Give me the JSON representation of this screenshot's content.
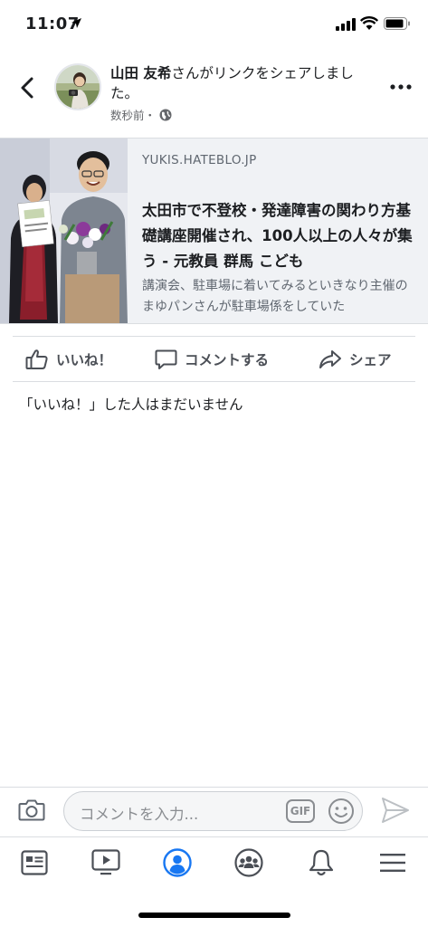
{
  "status_bar": {
    "time": "11:07"
  },
  "post": {
    "author": "山田 友希",
    "action_text": "さんがリンクをシェアしました。",
    "timestamp": "数秒前・"
  },
  "link_card": {
    "domain": "YUKIS.HATEBLO.JP",
    "title": "太田市で不登校・発達障害の関わり方基礎講座開催され、100人以上の人々が集う - 元教員 群馬 こども",
    "description": "講演会、駐車場に着いてみるといきなり主催のまゆパンさんが駐車場係をしていた"
  },
  "actions": {
    "like": "いいね！",
    "comment": "コメントする",
    "share": "シェア"
  },
  "likes_status": "「いいね！」した人はまだいません",
  "composer": {
    "placeholder": "コメントを入力...",
    "gif_label": "GIF"
  },
  "tab_bar": {
    "items": [
      "feed-icon",
      "watch-icon",
      "profile-icon",
      "groups-icon",
      "notifications-icon",
      "menu-icon"
    ],
    "active": "profile-icon",
    "active_color": "#1877f2",
    "icon_color": "#4b4f56"
  }
}
